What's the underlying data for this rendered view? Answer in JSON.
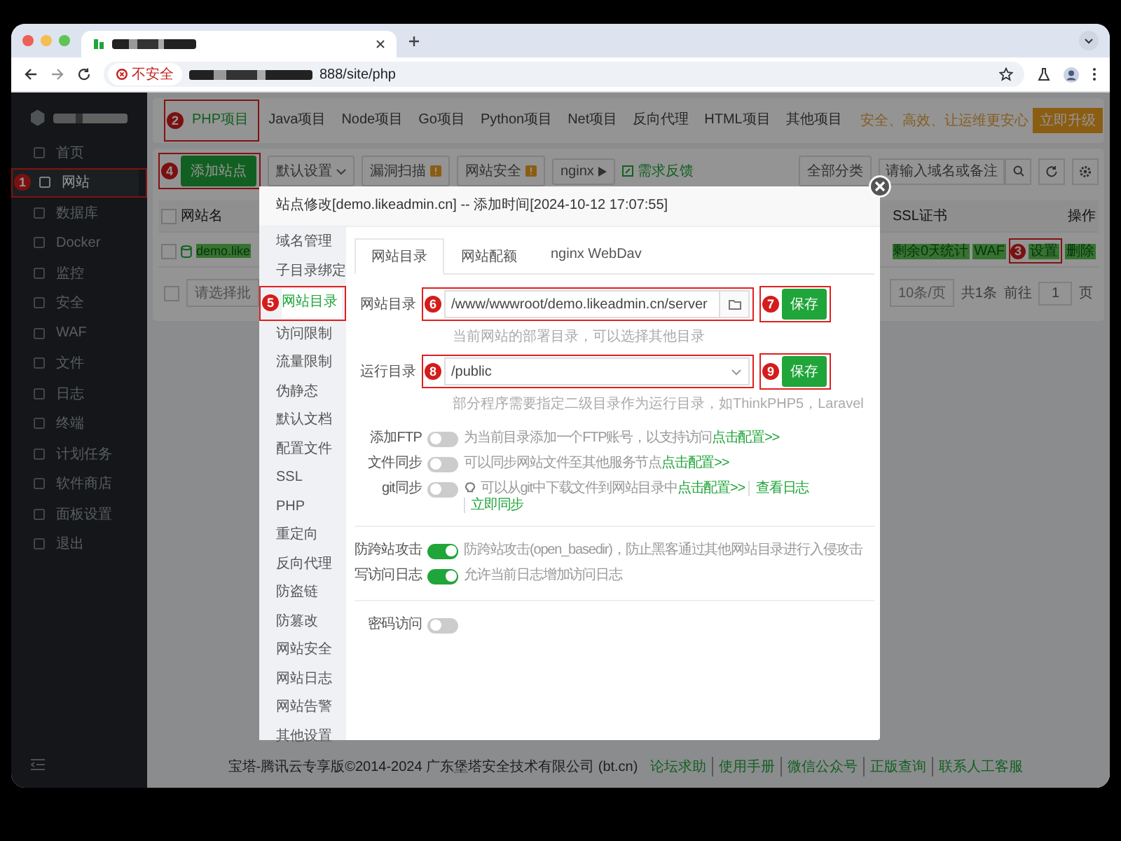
{
  "browser": {
    "security_label": "不安全",
    "url": "888/site/php"
  },
  "sidebar": {
    "items": [
      {
        "label": "首页",
        "selected": false
      },
      {
        "label": "网站",
        "selected": true,
        "callout": "1"
      },
      {
        "label": "数据库",
        "selected": false
      },
      {
        "label": "Docker",
        "selected": false
      },
      {
        "label": "监控",
        "selected": false
      },
      {
        "label": "安全",
        "selected": false
      },
      {
        "label": "WAF",
        "selected": false
      },
      {
        "label": "文件",
        "selected": false
      },
      {
        "label": "日志",
        "selected": false
      },
      {
        "label": "终端",
        "selected": false
      },
      {
        "label": "计划任务",
        "selected": false
      },
      {
        "label": "软件商店",
        "selected": false
      },
      {
        "label": "面板设置",
        "selected": false
      },
      {
        "label": "退出",
        "selected": false
      }
    ]
  },
  "project_tabs": [
    {
      "label": "PHP项目",
      "selected": true,
      "callout": "2"
    },
    {
      "label": "Java项目",
      "selected": false
    },
    {
      "label": "Node项目",
      "selected": false
    },
    {
      "label": "Go项目",
      "selected": false
    },
    {
      "label": "Python项目",
      "selected": false
    },
    {
      "label": "Net项目",
      "selected": false
    },
    {
      "label": "反向代理",
      "selected": false
    },
    {
      "label": "HTML项目",
      "selected": false
    },
    {
      "label": "其他项目",
      "selected": false
    }
  ],
  "promo": {
    "text": "安全、高效、让运维更安心",
    "button": "立即升级"
  },
  "toolbar": {
    "add_button": {
      "label": "添加站点",
      "callout": "4"
    },
    "items": [
      {
        "kind": "dropdown",
        "label": "默认设置"
      },
      {
        "kind": "badge",
        "label": "漏洞扫描"
      },
      {
        "kind": "badge",
        "label": "网站安全"
      },
      {
        "kind": "play",
        "label": "nginx"
      },
      {
        "kind": "link",
        "label": "需求反馈"
      }
    ],
    "category": "全部分类",
    "search_placeholder": "请输入域名或备注"
  },
  "table": {
    "header_checked": false,
    "name_header": "网站名",
    "right_headers": [
      "SSL证书",
      "操作"
    ],
    "row": {
      "checked": false,
      "name": "demo.like",
      "ssl": "剩余0天",
      "actions": [
        {
          "label": "统计"
        },
        {
          "label": "WAF"
        },
        {
          "label": "设置",
          "callout": "3"
        },
        {
          "label": "删除"
        }
      ]
    },
    "batch_checked": false,
    "batch_placeholder": "请选择批",
    "pager": {
      "size": "10条/页",
      "total": "共1条",
      "goto": "前往",
      "page": "1",
      "unit": "页"
    }
  },
  "modal": {
    "title": "站点修改[demo.likeadmin.cn] -- 添加时间[2024-10-12 17:07:55]",
    "nav": [
      {
        "label": "域名管理",
        "selected": false
      },
      {
        "label": "子目录绑定",
        "selected": false
      },
      {
        "label": "网站目录",
        "selected": true,
        "callout": "5"
      },
      {
        "label": "访问限制",
        "selected": false
      },
      {
        "label": "流量限制",
        "selected": false
      },
      {
        "label": "伪静态",
        "selected": false
      },
      {
        "label": "默认文档",
        "selected": false
      },
      {
        "label": "配置文件",
        "selected": false
      },
      {
        "label": "SSL",
        "selected": false
      },
      {
        "label": "PHP",
        "selected": false
      },
      {
        "label": "重定向",
        "selected": false
      },
      {
        "label": "反向代理",
        "selected": false
      },
      {
        "label": "防盗链",
        "selected": false
      },
      {
        "label": "防篡改",
        "selected": false
      },
      {
        "label": "网站安全",
        "selected": false
      },
      {
        "label": "网站日志",
        "selected": false
      },
      {
        "label": "网站告警",
        "selected": false
      },
      {
        "label": "其他设置",
        "selected": false
      }
    ],
    "tabs": [
      {
        "label": "网站目录",
        "selected": true
      },
      {
        "label": "网站配额",
        "selected": false
      },
      {
        "label": "nginx WebDav",
        "selected": false
      }
    ],
    "fields": [
      {
        "kind": "folder",
        "label": "网站目录",
        "value": "/www/wwwroot/demo.likeadmin.cn/server",
        "hint": "当前网站的部署目录，可以选择其他目录",
        "callout": "6",
        "save": {
          "label": "保存",
          "callout": "7"
        }
      },
      {
        "kind": "select",
        "label": "运行目录",
        "value": "/public",
        "hint": "部分程序需要指定二级目录作为运行目录，如ThinkPHP5，Laravel",
        "callout": "8",
        "save": {
          "label": "保存",
          "callout": "9"
        }
      }
    ],
    "option_groups": [
      [
        {
          "kind": "plain",
          "label": "添加FTP",
          "on": false,
          "text": "为当前目录添加一个FTP账号，以支持访问",
          "links": [
            "点击配置>>"
          ]
        },
        {
          "kind": "plain",
          "label": "文件同步",
          "on": false,
          "text": "可以同步网站文件至其他服务节点",
          "links": [
            "点击配置>>"
          ]
        },
        {
          "kind": "tip",
          "label": "git同步",
          "on": false,
          "text": "可以从git中下载文件到网站目录中",
          "links": [
            "点击配置>>",
            "查看日志",
            "立即同步"
          ]
        }
      ],
      [
        {
          "kind": "plain",
          "label": "防跨站攻击",
          "on": true,
          "text": "防跨站攻击(open_basedir)，防止黑客通过其他网站目录进行入侵攻击"
        },
        {
          "kind": "plain",
          "label": "写访问日志",
          "on": true,
          "text": "允许当前日志增加访问日志"
        }
      ],
      [
        {
          "kind": "plain",
          "label": "密码访问",
          "on": false
        }
      ]
    ]
  },
  "footer": {
    "copyright": "宝塔-腾讯云专享版©2014-2024 广东堡塔安全技术有限公司 (bt.cn)",
    "links": [
      "论坛求助",
      "使用手册",
      "微信公众号",
      "正版查询",
      "联系人工客服"
    ]
  }
}
